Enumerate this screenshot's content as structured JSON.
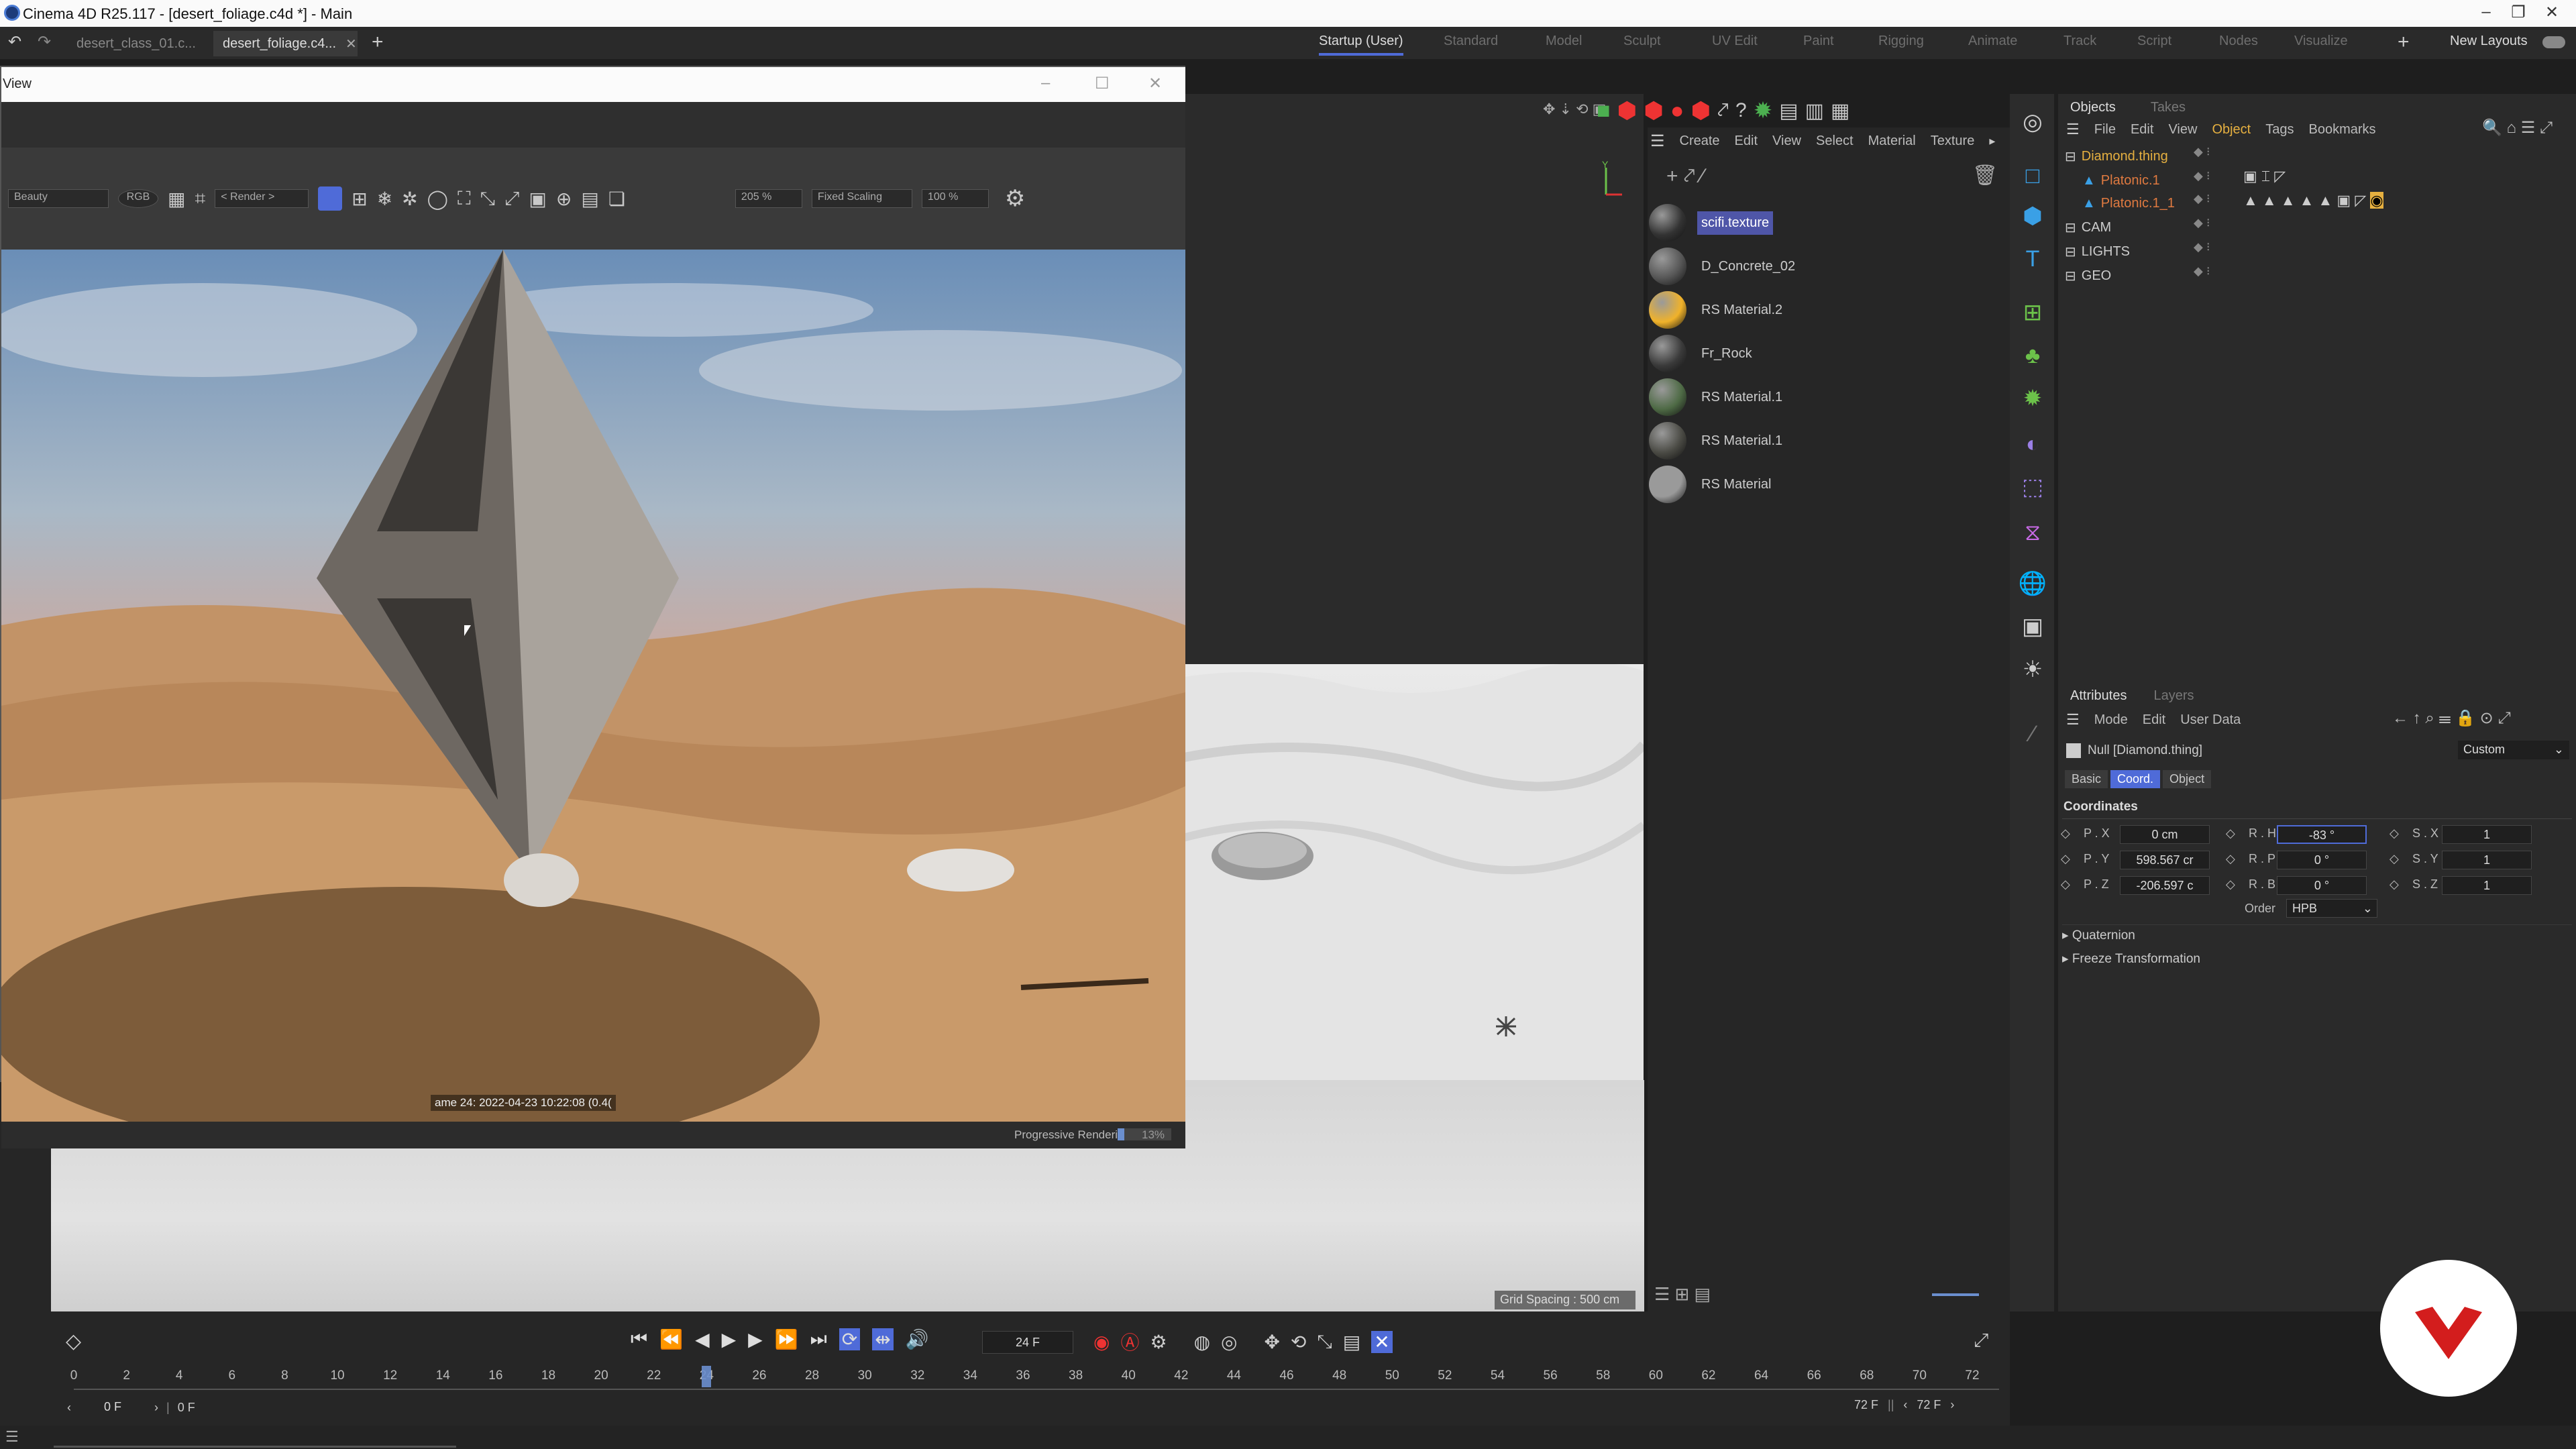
{
  "app": {
    "title": "Cinema 4D R25.117 - [desert_foliage.c4d *] - Main"
  },
  "doc_tabs": [
    "desert_class_01.c...",
    "desert_foliage.c4..."
  ],
  "layouts": {
    "items": [
      "Startup (User)",
      "Standard",
      "Model",
      "Sculpt",
      "UV Edit",
      "Paint",
      "Rigging",
      "Animate",
      "Track",
      "Script",
      "Nodes",
      "Visualize"
    ],
    "active": "Startup (User)",
    "new_layouts": "New Layouts"
  },
  "render_view": {
    "title": "View",
    "channel": "Beauty",
    "color_mode": "RGB",
    "render_select": "< Render >",
    "zoom": "205 %",
    "scaling": "Fixed Scaling",
    "percent": "100 %",
    "info": "ame 24: 2022-04-23 10:22:08 (0.4(",
    "status": "Progressive Renderin",
    "progress_text": "13%",
    "progress": 0.13
  },
  "viewport": {
    "grid_spacing": "Grid Spacing : 500 cm"
  },
  "material_manager": {
    "menu": [
      "Create",
      "Edit",
      "View",
      "Select",
      "Material",
      "Texture"
    ],
    "materials": [
      {
        "name": "scifi.texture",
        "color": "#333"
      },
      {
        "name": "D_Concrete_02",
        "color": "#555"
      },
      {
        "name": "RS Material.2",
        "color": "#f0b22a"
      },
      {
        "name": "Fr_Rock",
        "color": "#3a3a3a"
      },
      {
        "name": "RS Material.1",
        "color": "#4e6a45"
      },
      {
        "name": "RS Material.1",
        "color": "#4a4a44"
      },
      {
        "name": "RS Material",
        "color": "#9a9a9a"
      }
    ]
  },
  "objects": {
    "tabs": [
      "Objects",
      "Takes"
    ],
    "menu": [
      "File",
      "Edit",
      "View",
      "Object",
      "Tags",
      "Bookmarks"
    ],
    "rows": [
      {
        "name": "Diamond.thing",
        "color": "#e6b040"
      },
      {
        "name": "Platonic.1",
        "color": "#e07a40"
      },
      {
        "name": "Platonic.1_1",
        "color": "#e07a40"
      },
      {
        "name": "CAM",
        "color": "#ccc"
      },
      {
        "name": "LIGHTS",
        "color": "#ccc"
      },
      {
        "name": "GEO",
        "color": "#ccc"
      }
    ]
  },
  "attributes": {
    "tabs": [
      "Attributes",
      "Layers"
    ],
    "menu": [
      "Mode",
      "Edit",
      "User Data"
    ],
    "object": "Null [Diamond.thing]",
    "preset": "Custom",
    "subtabs": [
      "Basic",
      "Coord.",
      "Object"
    ],
    "section": "Coordinates",
    "pos": [
      {
        "l": "P . X",
        "v": "0 cm"
      },
      {
        "l": "P . Y",
        "v": "598.567 cr"
      },
      {
        "l": "P . Z",
        "v": "-206.597 c"
      }
    ],
    "rot": [
      {
        "l": "R . H",
        "v": "-83 °"
      },
      {
        "l": "R . P",
        "v": "0 °"
      },
      {
        "l": "R . B",
        "v": "0 °"
      }
    ],
    "scale": [
      {
        "l": "S . X",
        "v": "1"
      },
      {
        "l": "S . Y",
        "v": "1"
      },
      {
        "l": "S . Z",
        "v": "1"
      }
    ],
    "order_label": "Order",
    "order": "HPB",
    "quaternion": "Quaternion",
    "freeze": "Freeze Transformation"
  },
  "timeline": {
    "frame": "24 F",
    "start": "0 F",
    "min": "0 F",
    "end": "72 F",
    "max": "72 F",
    "ticks": [
      "0",
      "2",
      "4",
      "6",
      "8",
      "10",
      "12",
      "14",
      "16",
      "18",
      "20",
      "22",
      "24",
      "26",
      "28",
      "30",
      "32",
      "34",
      "36",
      "38",
      "40",
      "42",
      "44",
      "46",
      "48",
      "50",
      "52",
      "54",
      "56",
      "58",
      "60",
      "62",
      "64",
      "66",
      "68",
      "70",
      "72"
    ],
    "current": 24,
    "last": 72
  },
  "brand": {
    "accent": "#4f6bd8",
    "badge": "#d31d1d"
  }
}
